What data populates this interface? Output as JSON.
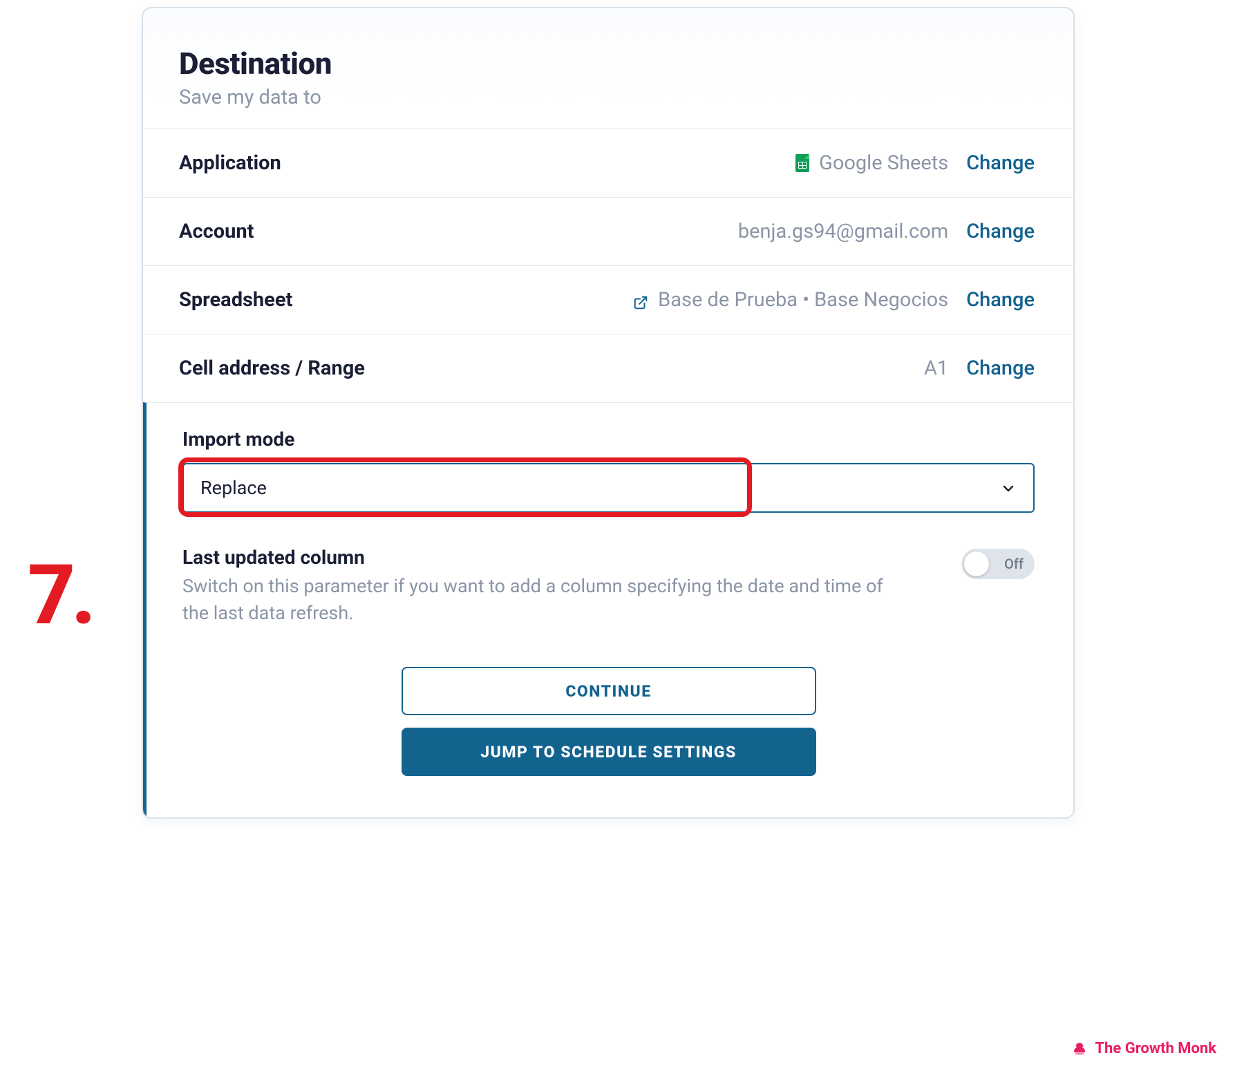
{
  "header": {
    "title": "Destination",
    "subtitle": "Save my data to"
  },
  "rows": {
    "application": {
      "label": "Application",
      "value": "Google Sheets",
      "action": "Change"
    },
    "account": {
      "label": "Account",
      "value": "benja.gs94@gmail.com",
      "action": "Change"
    },
    "spreadsheet": {
      "label": "Spreadsheet",
      "value": "Base de Prueba • Base Negocios",
      "action": "Change"
    },
    "cell": {
      "label": "Cell address / Range",
      "value": "A1",
      "action": "Change"
    }
  },
  "import_mode": {
    "label": "Import mode",
    "value": "Replace"
  },
  "last_updated": {
    "title": "Last updated column",
    "desc": "Switch on this parameter if you want to add a column specifying the date and time of the last data refresh.",
    "state": "Off"
  },
  "buttons": {
    "continue": "CONTINUE",
    "jump": "JUMP TO SCHEDULE SETTINGS"
  },
  "annotation": {
    "step": "7."
  },
  "brand": "The Growth Monk"
}
